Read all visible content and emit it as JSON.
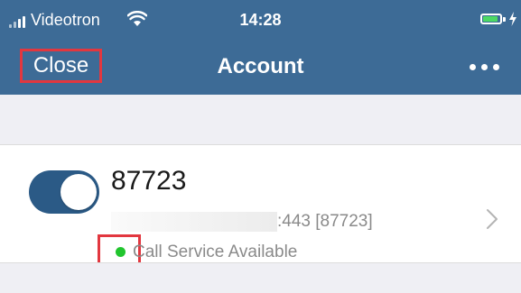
{
  "status_bar": {
    "carrier": "Videotron",
    "time": "14:28",
    "battery_color": "#4cd964"
  },
  "nav": {
    "close_label": "Close",
    "title": "Account",
    "more_icon": "more-dots-icon",
    "header_color": "#3d6b96",
    "highlight_color": "#e2373f"
  },
  "account": {
    "name": "87723",
    "server_detail": ":443 [87723]",
    "enabled": true,
    "status_text": "Call Service Available",
    "status_color": "#21c52e"
  }
}
